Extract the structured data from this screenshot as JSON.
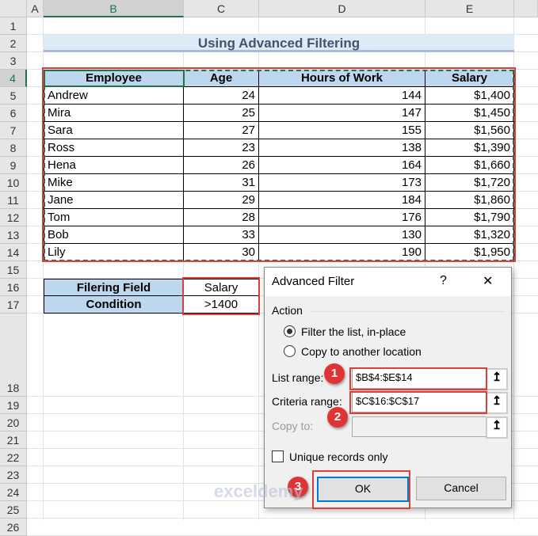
{
  "columns": [
    "A",
    "B",
    "C",
    "D",
    "E"
  ],
  "rows": [
    "1",
    "2",
    "3",
    "4",
    "5",
    "6",
    "7",
    "8",
    "9",
    "10",
    "11",
    "12",
    "13",
    "14",
    "15",
    "16",
    "17",
    "18",
    "19",
    "20",
    "21",
    "22",
    "23",
    "24",
    "25",
    "26"
  ],
  "title": "Using Advanced Filtering",
  "table": {
    "headers": [
      "Employee",
      "Age",
      "Hours of Work",
      "Salary"
    ],
    "rows": [
      [
        "Andrew",
        "24",
        "144",
        "$1,400"
      ],
      [
        "Mira",
        "25",
        "147",
        "$1,450"
      ],
      [
        "Sara",
        "27",
        "155",
        "$1,560"
      ],
      [
        "Ross",
        "23",
        "138",
        "$1,390"
      ],
      [
        "Hena",
        "26",
        "164",
        "$1,660"
      ],
      [
        "Mike",
        "31",
        "173",
        "$1,720"
      ],
      [
        "Jane",
        "29",
        "184",
        "$1,860"
      ],
      [
        "Tom",
        "28",
        "176",
        "$1,790"
      ],
      [
        "Bob",
        "33",
        "130",
        "$1,320"
      ],
      [
        "Lily",
        "30",
        "190",
        "$1,950"
      ]
    ]
  },
  "criteria": {
    "field_label": "Filering Field",
    "field_value": "Salary",
    "condition_label": "Condition",
    "condition_value": ">1400"
  },
  "dialog": {
    "title": "Advanced Filter",
    "help": "?",
    "close": "✕",
    "action_label": "Action",
    "option_inplace": "Filter the list, in-place",
    "option_copy": "Copy to another location",
    "list_range_label": "List range:",
    "list_range_value": "$B$4:$E$14",
    "criteria_range_label": "Criteria range:",
    "criteria_range_value": "$C$16:$C$17",
    "copy_to_label": "Copy to:",
    "copy_to_value": "",
    "unique_label": "Unique records only",
    "ok": "OK",
    "cancel": "Cancel",
    "ref_icon": "↥"
  },
  "badges": [
    "1",
    "2",
    "3"
  ],
  "watermark": "exceldemy"
}
